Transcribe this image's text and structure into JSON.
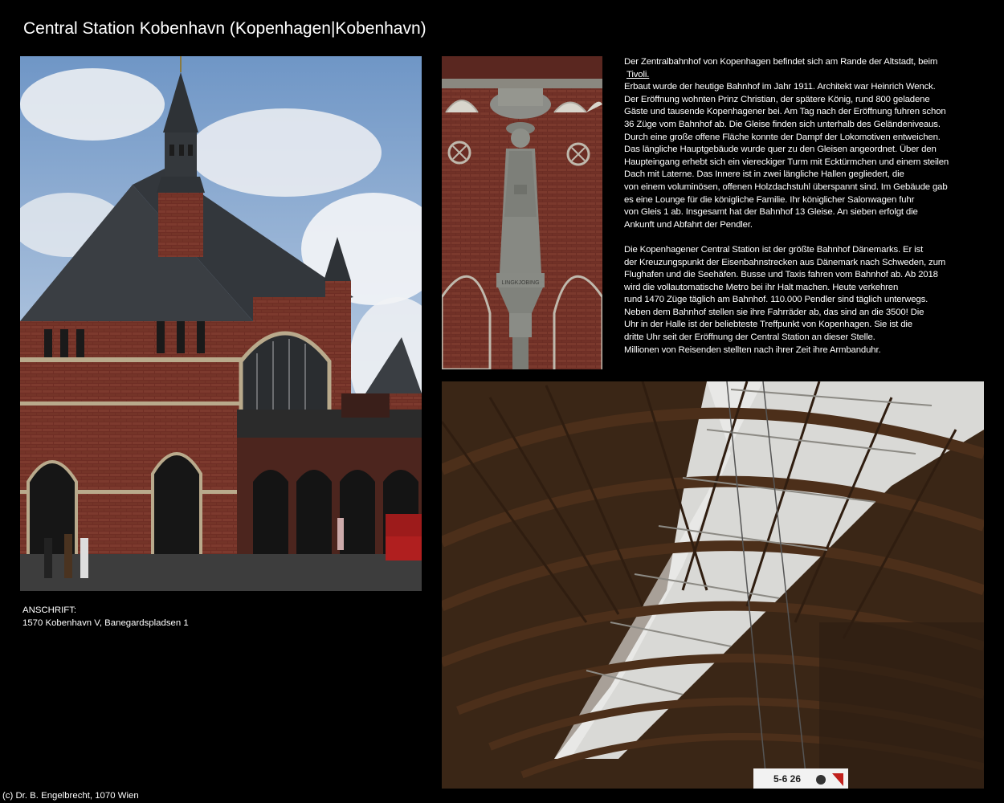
{
  "page": {
    "title": "Central Station Kobenhavn (Kopenhagen|Kobenhavn)"
  },
  "description": {
    "paragraph1": {
      "lines": [
        "Der Zentralbahnhof von Kopenhagen befindet sich am Rande der Altstadt, beim"
      ],
      "link_text": "Tivoli.",
      "continuation": [
        "Erbaut wurde der heutige Bahnhof im Jahr 1911. Architekt war Heinrich Wenck.",
        "Der Eröffnung wohnten Prinz Christian, der spätere König, rund 800 geladene",
        "Gäste und tausende Kopenhagener bei. Am Tag nach der Eröffnung fuhren schon",
        "36 Züge vom Bahnhof ab. Die Gleise finden sich unterhalb des Geländeniveaus.",
        "Durch eine große offene Fläche konnte der Dampf der Lokomotiven entweichen.",
        "Das längliche Hauptgebäude wurde quer zu den Gleisen angeordnet. Über den",
        "Haupteingang erhebt sich ein viereckiger Turm mit Ecktürmchen und einem steilen",
        "Dach mit Laterne. Das Innere ist in zwei längliche Hallen gegliedert, die",
        "von einem voluminösen, offenen Holzdachstuhl überspannt sind. Im Gebäude gab",
        "es eine Lounge für die königliche Familie. Ihr königlicher Salonwagen fuhr",
        "von Gleis 1 ab. Insgesamt hat der Bahnhof 13 Gleise. An sieben erfolgt die",
        "Ankunft und Abfahrt der Pendler."
      ]
    },
    "paragraph2": {
      "lines": [
        "Die Kopenhagener Central Station ist der größte Bahnhof Dänemarks. Er ist",
        "der Kreuzungspunkt der Eisenbahnstrecken aus Dänemark nach Schweden, zum",
        "Flughafen und die Seehäfen. Busse und Taxis fahren vom Bahnhof ab. Ab 2018",
        "wird die vollautomatische Metro bei ihr Halt machen. Heute verkehren",
        "rund 1470 Züge täglich am Bahnhof. 110.000 Pendler sind täglich unterwegs.",
        "Neben dem Bahnhof stellen sie ihre Fahrräder ab, das sind an die 3500! Die",
        "Uhr in der Halle ist der beliebteste Treffpunkt von Kopenhagen. Sie ist die",
        "dritte Uhr seit der Eröffnung der Central Station an dieser Stelle.",
        "Millionen von Reisenden stellten nach ihrer Zeit ihre Armbanduhr."
      ]
    }
  },
  "address": {
    "label": "ANSCHRIFT:",
    "value": "1570 Kobenhavn V, Banegardspladsen 1"
  },
  "photos": {
    "relief_inscription": "LINGKJOBING",
    "hall_sign": "5-6 26"
  },
  "footer": {
    "copyright": "(c) Dr. B. Engelbrecht, 1070 Wien"
  },
  "colors": {
    "background": "#000000",
    "text": "#ffffff",
    "brick": "#7a3328",
    "slate_roof": "#3b3f44",
    "sky": "#7fa4cf",
    "stone": "#8b8d88",
    "timber": "#5a3a22",
    "skylight": "#e8e8e6"
  }
}
